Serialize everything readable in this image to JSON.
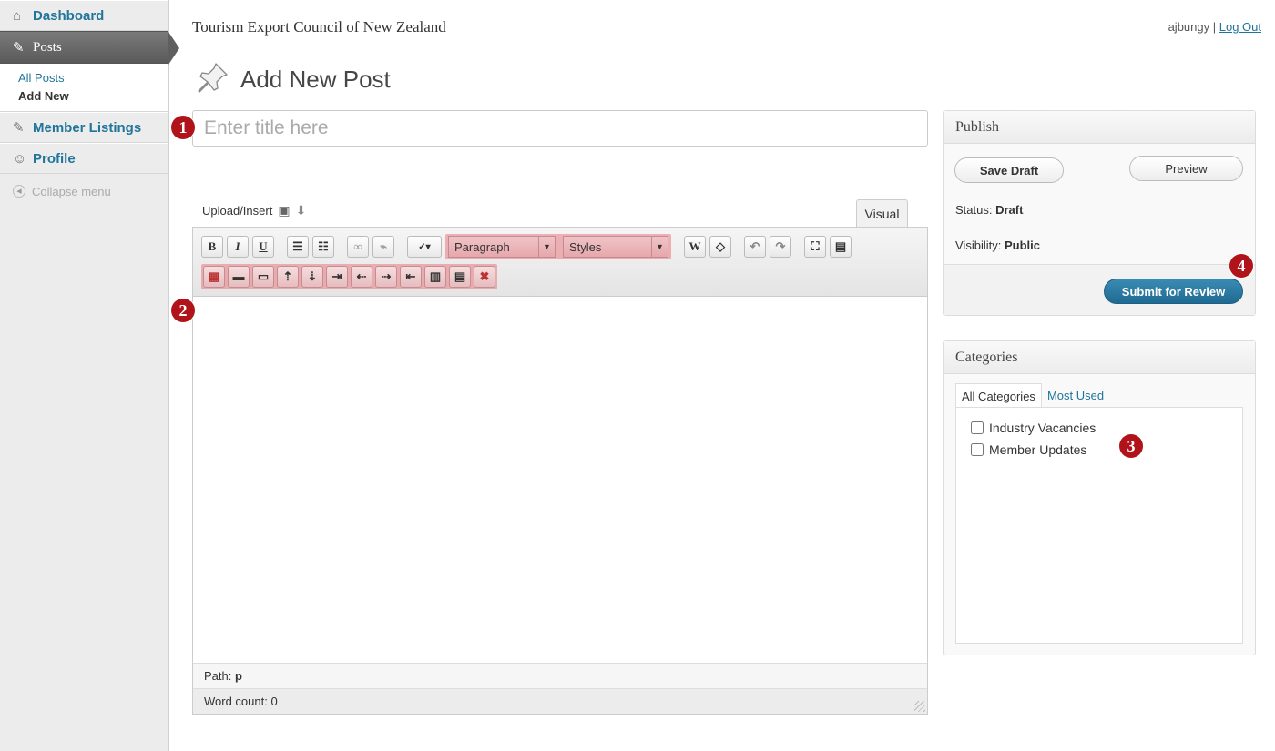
{
  "sidebar": {
    "dashboard_label": "Dashboard",
    "posts_label": "Posts",
    "posts_submenu": [
      "All Posts",
      "Add New"
    ],
    "member_listings_label": "Member Listings",
    "profile_label": "Profile",
    "collapse_label": "Collapse menu"
  },
  "header": {
    "site_title": "Tourism Export Council of New Zealand",
    "username": "ajbungy",
    "separator": " | ",
    "logout_label": "Log Out"
  },
  "page": {
    "title": "Add New Post",
    "title_placeholder": "Enter title here"
  },
  "editor": {
    "upload_label": "Upload/Insert",
    "visual_tab": "Visual",
    "format_select": "Paragraph",
    "styles_select": "Styles",
    "path_label": "Path:",
    "path_value": "p",
    "word_count": "Word count: 0"
  },
  "publish": {
    "title": "Publish",
    "save_draft_label": "Save Draft",
    "preview_label": "Preview",
    "status_label": "Status:",
    "status_value": "Draft",
    "visibility_label": "Visibility:",
    "visibility_value": "Public",
    "submit_label": "Submit for Review"
  },
  "categories": {
    "title": "Categories",
    "tabs": [
      "All Categories",
      "Most Used"
    ],
    "items": [
      "Industry Vacancies",
      "Member Updates"
    ]
  },
  "badges": [
    "1",
    "2",
    "3",
    "4"
  ],
  "colors": {
    "link": "#21759b",
    "badge": "#b01319",
    "primary_button": "#2a7aa3",
    "highlight": "#e57882"
  }
}
